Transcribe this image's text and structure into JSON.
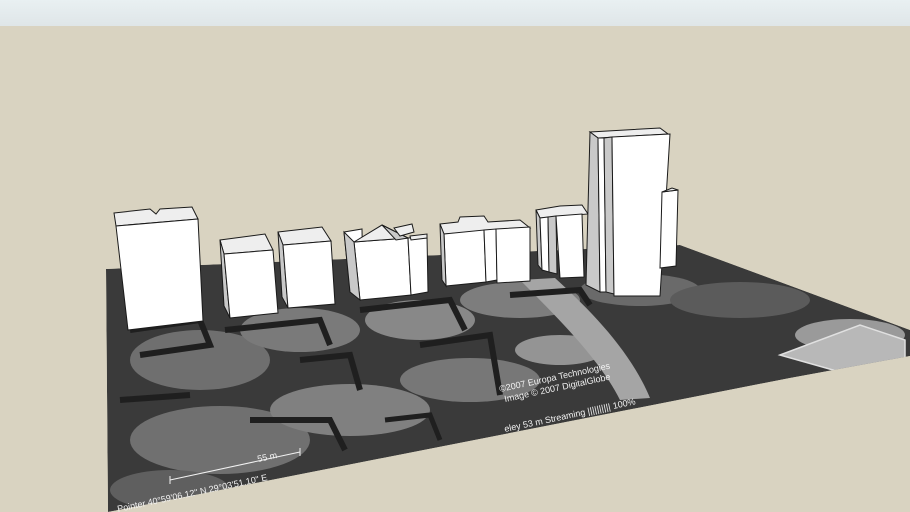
{
  "scene": {
    "colors": {
      "sky": "#e9f0f2",
      "ground": "#d9d3c1",
      "building_front": "#ffffff",
      "building_side": "#c9c9c9",
      "terrain_dark": "#3a3a3a"
    },
    "overlay": {
      "copyright_line1": "©2007 Europa Technologies",
      "copyright_line2": "Image © 2007 DigitalGlobe",
      "streaming": "eley 53 m   Streaming |||||||||| 100%",
      "coordinates": "Pointer 40°59'06.12\" N    29°03'51.10\" E",
      "scale_label": "55 m"
    }
  }
}
